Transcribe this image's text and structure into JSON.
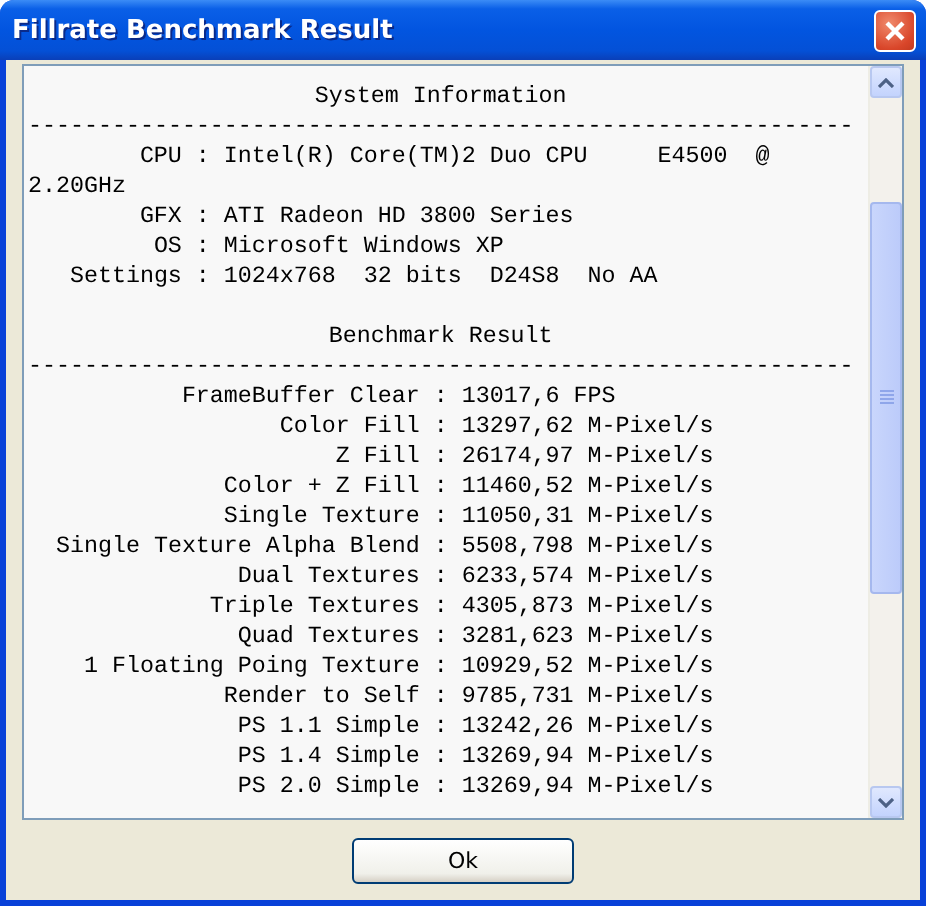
{
  "window": {
    "title": "Fillrate Benchmark Result"
  },
  "sections": [
    {
      "heading": "System Information",
      "rule": "-----------------------------------------------------------",
      "kind": "system",
      "rows": [
        {
          "label": "CPU :",
          "value": "Intel(R) Core(TM)2 Duo CPU     E4500  @ 2.20GHz"
        },
        {
          "label": "GFX :",
          "value": "ATI Radeon HD 3800 Series"
        },
        {
          "label": "OS :",
          "value": "Microsoft Windows XP"
        },
        {
          "label": "Settings :",
          "value": "1024x768  32 bits  D24S8  No AA"
        }
      ]
    },
    {
      "heading": "Benchmark Result",
      "rule": "-----------------------------------------------------------",
      "kind": "benchmark",
      "rows": [
        {
          "label": "FrameBuffer Clear :",
          "value": "13017,6 FPS"
        },
        {
          "label": "Color Fill :",
          "value": "13297,62 M-Pixel/s"
        },
        {
          "label": "Z Fill :",
          "value": "26174,97 M-Pixel/s"
        },
        {
          "label": "Color + Z Fill :",
          "value": "11460,52 M-Pixel/s"
        },
        {
          "label": "Single Texture :",
          "value": "11050,31 M-Pixel/s"
        },
        {
          "label": "Single Texture Alpha Blend :",
          "value": "5508,798 M-Pixel/s"
        },
        {
          "label": "Dual Textures :",
          "value": "6233,574 M-Pixel/s"
        },
        {
          "label": "Triple Textures :",
          "value": "4305,873 M-Pixel/s"
        },
        {
          "label": "Quad Textures :",
          "value": "3281,623 M-Pixel/s"
        },
        {
          "label": "1 Floating Poing Texture :",
          "value": "10929,52 M-Pixel/s"
        },
        {
          "label": "Render to Self :",
          "value": "9785,731 M-Pixel/s"
        },
        {
          "label": "PS 1.1 Simple :",
          "value": "13242,26 M-Pixel/s"
        },
        {
          "label": "PS 1.4 Simple :",
          "value": "13269,94 M-Pixel/s"
        },
        {
          "label": "PS 2.0 Simple :",
          "value": "13269,94 M-Pixel/s"
        }
      ]
    }
  ],
  "buttons": [
    "Ok"
  ]
}
